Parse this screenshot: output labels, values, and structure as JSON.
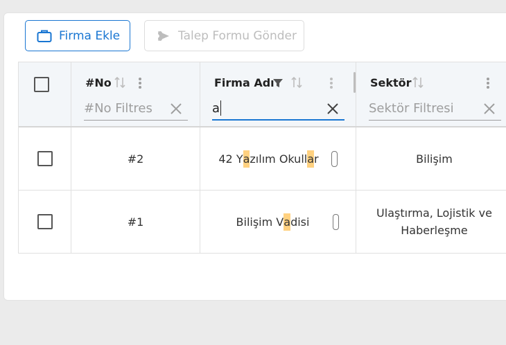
{
  "toolbar": {
    "add_company_label": "Firma Ekle",
    "send_form_label": "Talep Formu Gönder"
  },
  "columns": {
    "no": {
      "title": "#No",
      "filter_placeholder": "#No Filtres"
    },
    "company": {
      "title": "Firma Adı",
      "filter_value": "a"
    },
    "sector": {
      "title": "Sektör",
      "filter_placeholder": "Sektör Filtresi"
    }
  },
  "rows": [
    {
      "no": "#2",
      "company_parts": [
        "42 Y",
        "a",
        "zılım Okull",
        "a",
        "r"
      ],
      "sector": "Bilişim"
    },
    {
      "no": "#1",
      "company_parts": [
        "Bilişim V",
        "a",
        "disi"
      ],
      "sector": "Ulaştırma, Lojistik ve Haberleşme"
    }
  ],
  "colors": {
    "accent": "#1976d2",
    "highlight": "#ffd180",
    "header_bg": "#f3f6f9"
  }
}
